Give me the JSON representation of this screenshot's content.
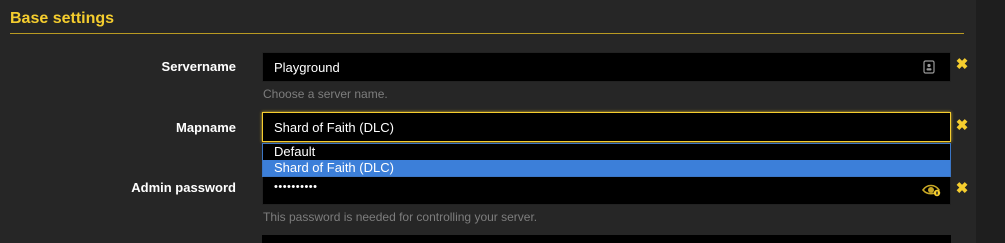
{
  "section": {
    "title": "Base settings"
  },
  "servername": {
    "label": "Servername",
    "value": "Playground",
    "help": "Choose a server name."
  },
  "mapname": {
    "label": "Mapname",
    "value": "Shard of Faith (DLC)",
    "options": [
      "Default",
      "Shard of Faith (DLC)"
    ],
    "selected_index": 1
  },
  "admin_password": {
    "label": "Admin password",
    "masked_value": "••••••••••",
    "help": "This password is needed for controlling your server."
  },
  "icons": {
    "clear": "✖",
    "contact_card": "contact-card-icon",
    "reveal_password": "eye-reveal-icon"
  },
  "colors": {
    "accent": "#f5cd2e",
    "background": "#262626",
    "input_bg": "#000000",
    "selected_option": "#3c7fd9",
    "help_text": "#7d7d7d"
  }
}
